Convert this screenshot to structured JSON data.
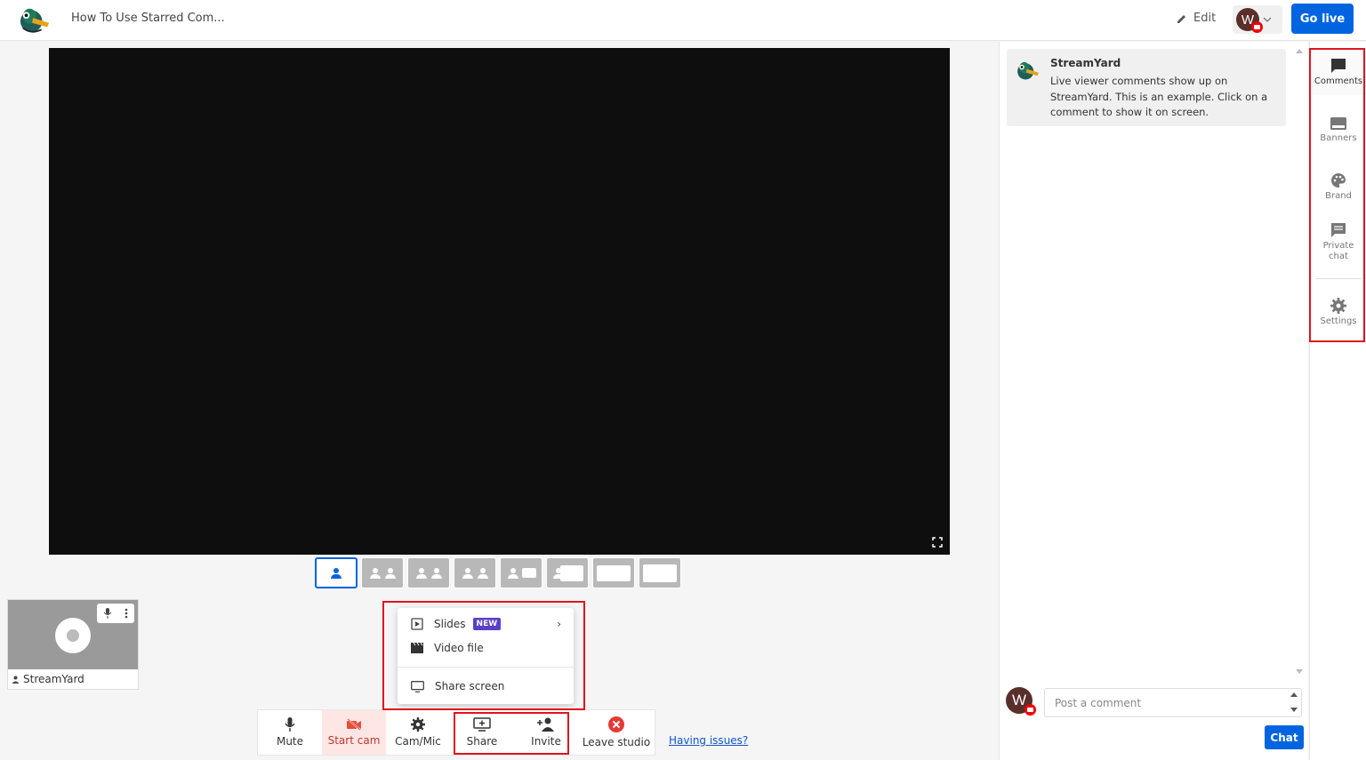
{
  "header": {
    "title": "How To Use Starred Com...",
    "edit_label": "Edit",
    "avatar_initial": "W",
    "go_live_label": "Go live"
  },
  "participant": {
    "name": "StreamYard"
  },
  "share_menu": {
    "items": [
      {
        "label": "Slides",
        "badge": "NEW"
      },
      {
        "label": "Video file"
      },
      {
        "label": "Share screen"
      }
    ]
  },
  "controls": {
    "mute": "Mute",
    "start_cam": "Start cam",
    "cam_mic": "Cam/Mic",
    "share": "Share",
    "invite": "Invite",
    "leave": "Leave studio",
    "issues_link": "Having issues?"
  },
  "comments": {
    "card_author": "StreamYard",
    "card_text": "Live viewer comments show up on StreamYard. This is an example. Click on a comment to show it on screen.",
    "input_placeholder": "Post a comment",
    "chat_button": "Chat"
  },
  "sidebar": {
    "items": [
      {
        "label": "Comments",
        "icon": "comment-icon"
      },
      {
        "label": "Banners",
        "icon": "banner-icon"
      },
      {
        "label": "Brand",
        "icon": "palette-icon"
      },
      {
        "label": "Private chat",
        "icon": "chat-icon"
      },
      {
        "label": "Settings",
        "icon": "gear-icon"
      }
    ]
  },
  "colors": {
    "accent": "#0064e0",
    "highlight": "#e0141e",
    "new_badge": "#5b3fc7",
    "cam_off": "#e74c3c",
    "leave": "#e53935"
  }
}
